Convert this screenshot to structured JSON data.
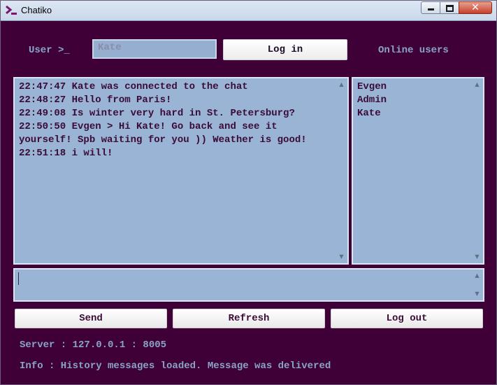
{
  "window": {
    "title": "Chatiko",
    "close_glyph": "✕"
  },
  "login": {
    "user_label": "User >_",
    "user_value": "Kate",
    "login_button": "Log in"
  },
  "online_users": {
    "label": "Online users",
    "users": [
      "Evgen",
      "Admin",
      "Kate"
    ]
  },
  "chat": {
    "messages": [
      "22:47:47 Kate was connected to the chat",
      "22:48:27 Hello from Paris!",
      "22:49:08 Is winter very hard in St. Petersburg?",
      "22:50:50 Evgen > Hi Kate! Go back and see it yourself! Spb waiting for you )) Weather is good!",
      "22:51:18 i will!"
    ]
  },
  "message_input": {
    "value": ""
  },
  "buttons": {
    "send": "Send",
    "refresh": "Refresh",
    "logout": "Log out"
  },
  "status": {
    "server": "Server : 127.0.0.1 : 8005",
    "info": "Info : History messages loaded. Message was delivered"
  },
  "colors": {
    "background": "#3f0038",
    "panel": "#99b4d4",
    "label_text": "#8aa4c6",
    "panel_text": "#3a0b36"
  },
  "icons": {
    "app": "terminal-prompt-icon",
    "scroll_up": "▲",
    "scroll_down": "▼"
  }
}
